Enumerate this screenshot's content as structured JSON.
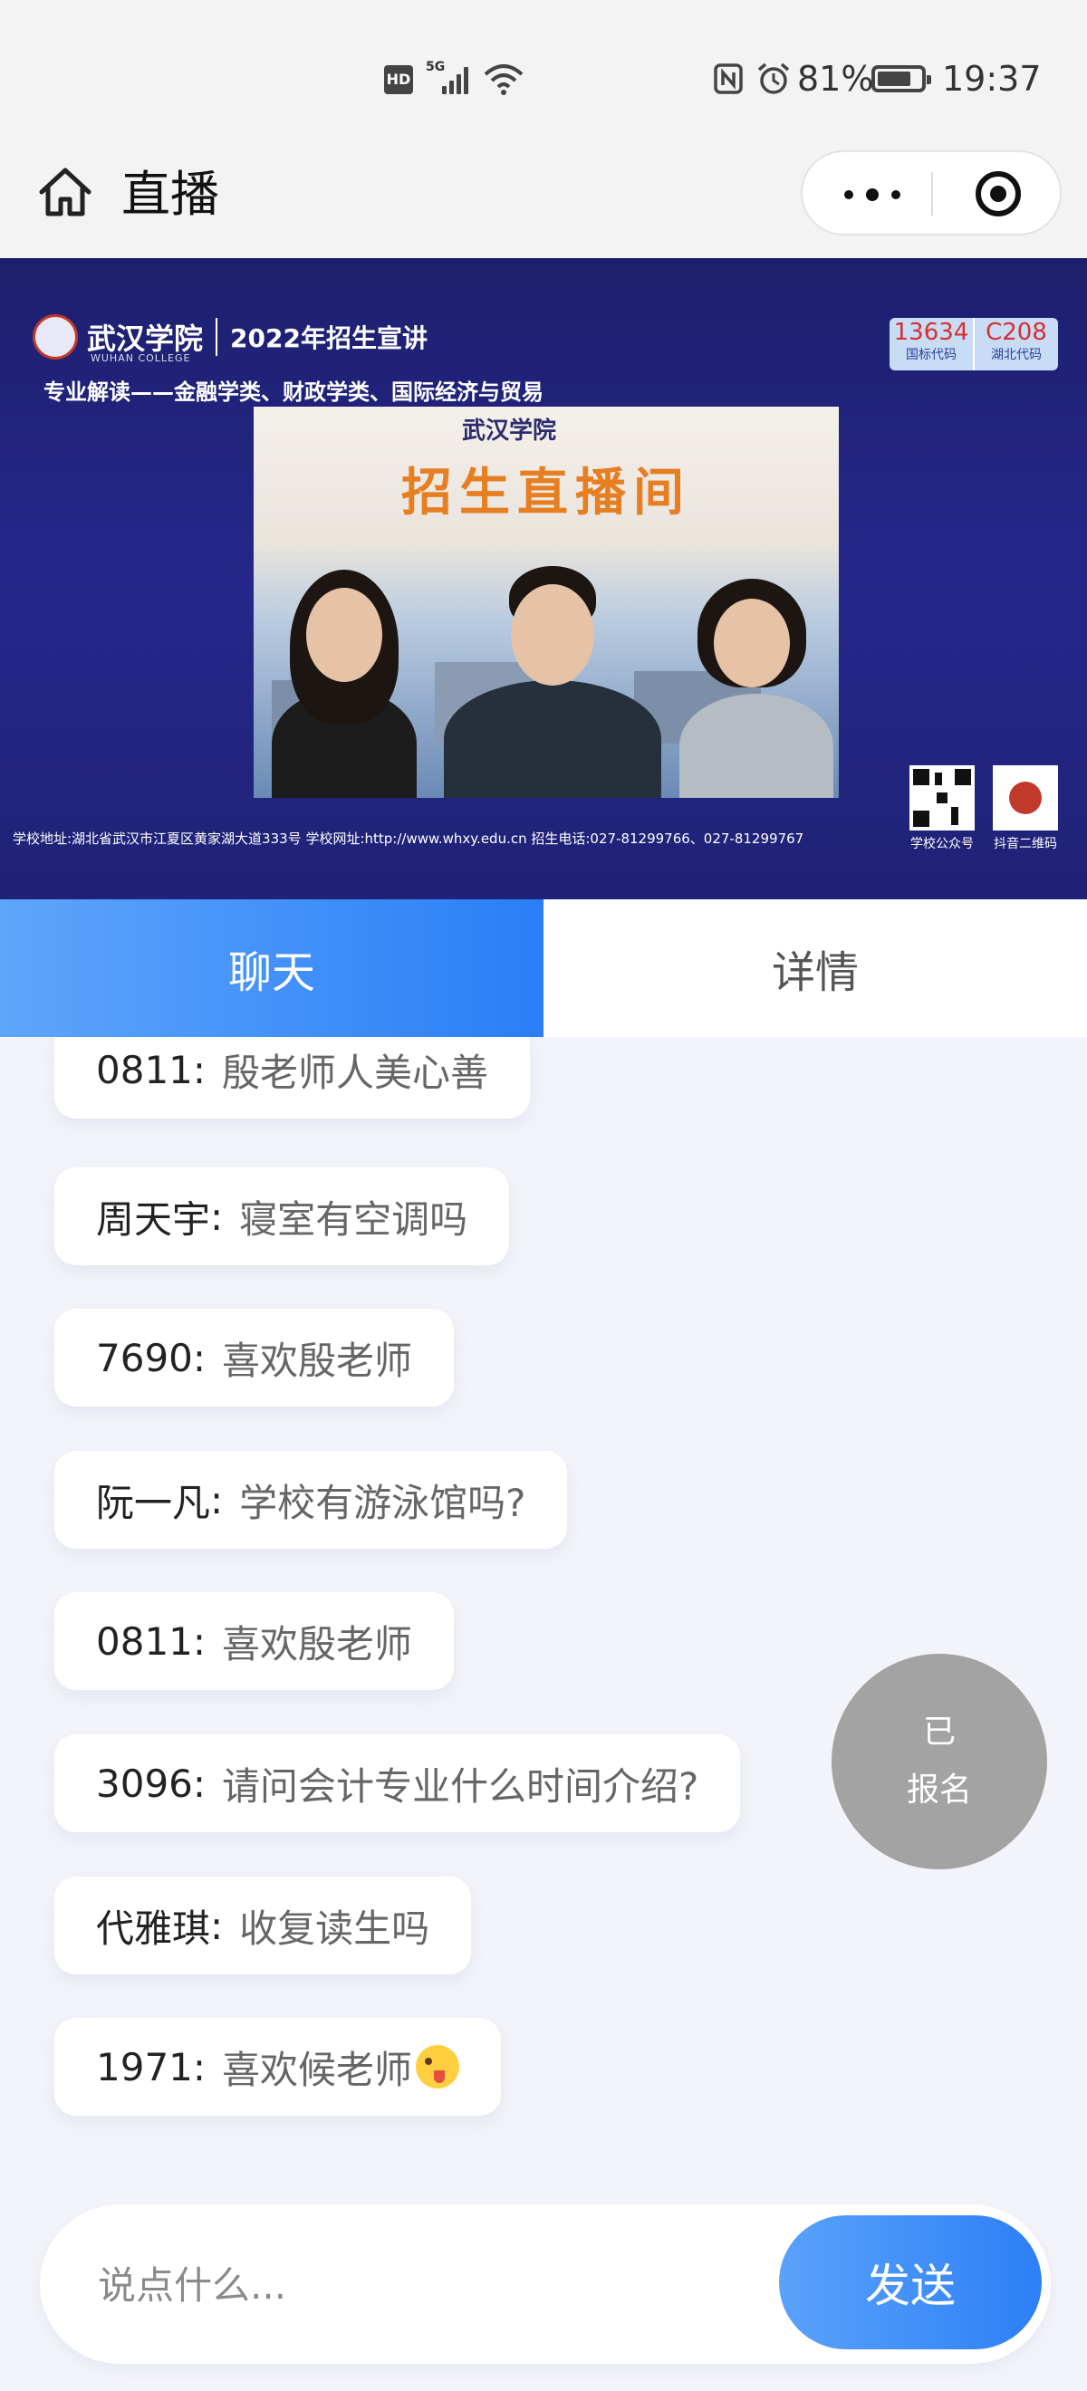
{
  "status_bar": {
    "hd": "HD",
    "network": "5G",
    "battery_text": "81%",
    "battery_level": 0.81,
    "time": "19:37"
  },
  "nav": {
    "title": "直播"
  },
  "video": {
    "school_name": "武汉学院",
    "school_name_en": "WUHAN COLLEGE",
    "event": "2022年招生宣讲",
    "subtitle": "专业解读——金融学类、财政学类、国际经济与贸易",
    "code_national": "13634",
    "code_national_label": "国标代码",
    "code_hubei": "C208",
    "code_hubei_label": "湖北代码",
    "screen_logo": "武汉学院",
    "screen_title": "招生直播间",
    "footer": "学校地址:湖北省武汉市江夏区黄家湖大道333号  学校网址:http://www.whxy.edu.cn  招生电话:027-81299766、027-81299767",
    "qr1_label": "学校公众号",
    "qr2_label": "抖音二维码"
  },
  "tabs": [
    {
      "label": "聊天",
      "active": true
    },
    {
      "label": "详情",
      "active": false
    }
  ],
  "messages": [
    {
      "name": "0811",
      "text": "殷老师人美心善"
    },
    {
      "name": "周天宇",
      "text": "寝室有空调吗"
    },
    {
      "name": "7690",
      "text": "喜欢殷老师"
    },
    {
      "name": "阮一凡",
      "text": "学校有游泳馆吗?"
    },
    {
      "name": "0811",
      "text": " 喜欢殷老师"
    },
    {
      "name": "3096",
      "text": "请问会计专业什么时间介绍?"
    },
    {
      "name": "代雅琪",
      "text": "收复读生吗"
    },
    {
      "name": "1971",
      "text": "喜欢候老师"
    }
  ],
  "signup": {
    "line1": "已",
    "line2": "报名"
  },
  "composer": {
    "placeholder": "说点什么...",
    "send_label": "发送"
  },
  "colors": {
    "accent": "#2b7ef7",
    "video_bg": "#25288a",
    "page_bg": "#f3f4f9",
    "signup_bg": "#a3a3a3"
  }
}
